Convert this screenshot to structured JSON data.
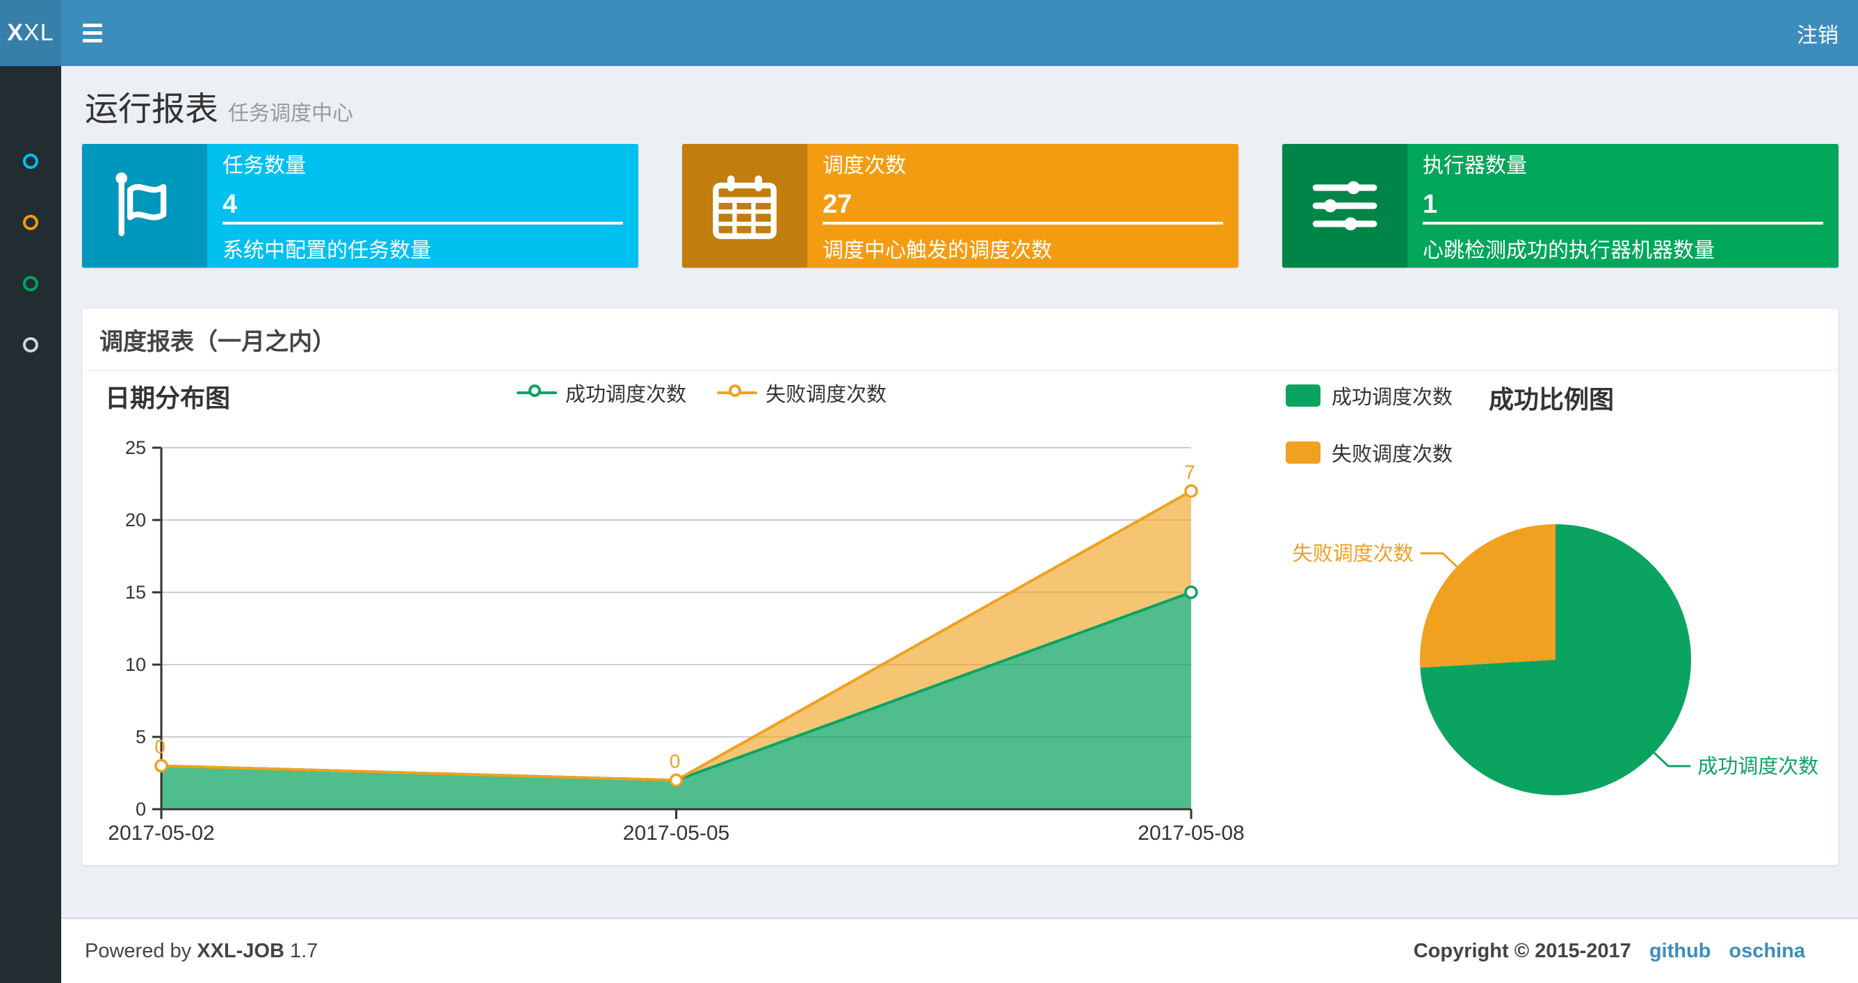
{
  "header": {
    "logo_bold": "X",
    "logo_rest": "XL",
    "logout_label": "注销",
    "bar_color": "#3c8dbc",
    "logo_bg": "#367fa9"
  },
  "sidebar": {
    "bg": "#222d32",
    "items": [
      {
        "label": "menu-item-1",
        "icon": "circle-o-icon",
        "color": "#00c0ef"
      },
      {
        "label": "menu-item-2",
        "icon": "circle-o-icon",
        "color": "#f39c12"
      },
      {
        "label": "menu-item-3",
        "icon": "circle-o-icon",
        "color": "#00a65a"
      },
      {
        "label": "menu-item-4",
        "icon": "circle-o-icon",
        "color": "#d2d6de"
      }
    ]
  },
  "page": {
    "title": "运行报表",
    "subtitle": "任务调度中心"
  },
  "stat_cards": [
    {
      "label": "任务数量",
      "value": "4",
      "description": "系统中配置的任务数量",
      "color": "#00c0ef",
      "icon_bg": "#0097bc",
      "icon": "flag-icon"
    },
    {
      "label": "调度次数",
      "value": "27",
      "description": "调度中心触发的调度次数",
      "color": "#f39c12",
      "icon_bg": "#c17d0e",
      "icon": "calendar-icon"
    },
    {
      "label": "执行器数量",
      "value": "1",
      "description": "心跳检测成功的执行器机器数量",
      "color": "#00a65a",
      "icon_bg": "#008549",
      "icon": "sliders-icon"
    }
  ],
  "panel": {
    "title": "调度报表（一月之内）"
  },
  "chart_data": [
    {
      "type": "area",
      "title": "日期分布图",
      "stacked": true,
      "x": [
        "2017-05-02",
        "2017-05-05",
        "2017-05-08"
      ],
      "series": [
        {
          "name": "成功调度次数",
          "values": [
            3,
            2,
            15
          ],
          "color": "#0ba360",
          "fill_opacity": 0.72,
          "show_point_labels": false
        },
        {
          "name": "失败调度次数",
          "values": [
            0,
            0,
            7
          ],
          "color": "#efa11f",
          "fill_opacity": 0.62,
          "show_point_labels": true
        }
      ],
      "ylim": [
        0,
        25
      ],
      "ytick_step": 5,
      "grid": true,
      "legend_position": "top-center",
      "axis_color": "#333333",
      "grid_color": "#cccccc"
    },
    {
      "type": "pie",
      "title": "成功比例图",
      "slices": [
        {
          "name": "成功调度次数",
          "value": 20,
          "color": "#0ba360"
        },
        {
          "name": "失败调度次数",
          "value": 7,
          "color": "#efa11f"
        }
      ],
      "legend_position": "top-left"
    }
  ],
  "footer": {
    "powered_prefix": "Powered by",
    "product": "XXL-JOB",
    "version": "1.7",
    "copyright": "Copyright © 2015-2017",
    "links": [
      "github",
      "oschina"
    ]
  }
}
